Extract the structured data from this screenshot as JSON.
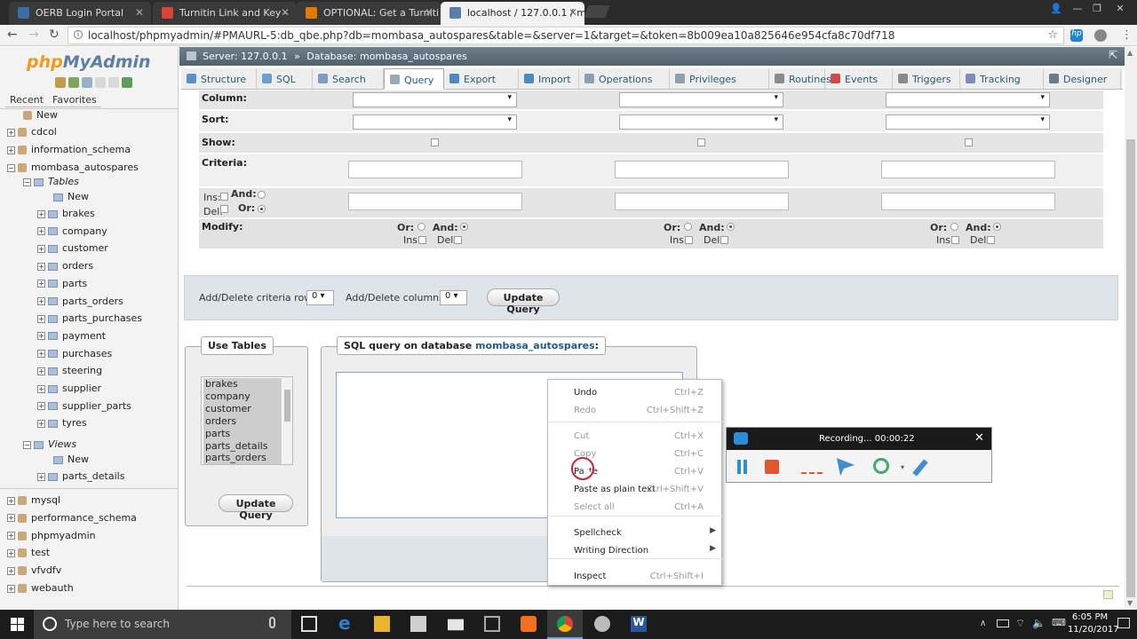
{
  "browser": {
    "tabs": [
      {
        "title": "OERB Login Portal",
        "favicon_color": "#3a6ea5"
      },
      {
        "title": "Turnitin Link and Key -",
        "favicon_color": "#d44638"
      },
      {
        "title": "OPTIONAL: Get a Turniti",
        "favicon_color": "#e07b00"
      },
      {
        "title": "localhost / 127.0.0.1 / m",
        "favicon_color": "#5c7ea9"
      }
    ],
    "url": "localhost/phpmyadmin/#PMAURL-5:db_qbe.php?db=mombasa_autospares&table=&server=1&target=&token=8b009ea10a825646e954cfa8c70df718"
  },
  "sidebar": {
    "logo_php": "php",
    "logo_my": "MyAdmin",
    "tab_recent": "Recent",
    "tab_favorites": "Favorites",
    "new_label": "New",
    "databases_top": [
      "cdcol",
      "information_schema"
    ],
    "active_db": "mombasa_autospares",
    "tables_label": "Tables",
    "tables_new": "New",
    "tables": [
      "brakes",
      "company",
      "customer",
      "orders",
      "parts",
      "parts_orders",
      "parts_purchases",
      "payment",
      "purchases",
      "steering",
      "supplier",
      "supplier_parts",
      "tyres"
    ],
    "views_label": "Views",
    "views_new": "New",
    "views": [
      "parts_details"
    ],
    "databases_bottom": [
      "mysql",
      "performance_schema",
      "phpmyadmin",
      "test",
      "vfvdfv",
      "webauth"
    ]
  },
  "main": {
    "breadcrumb_server": "Server: 127.0.0.1",
    "breadcrumb_db": "Database: mombasa_autospares",
    "tabs": [
      {
        "label": "Structure",
        "color": "#5a8fc7"
      },
      {
        "label": "SQL",
        "color": "#6a9fd3"
      },
      {
        "label": "Search",
        "color": "#7b9ec2"
      },
      {
        "label": "Query",
        "color": "#9aa9b7"
      },
      {
        "label": "Export",
        "color": "#4e8ac0"
      },
      {
        "label": "Import",
        "color": "#4e8ac0"
      },
      {
        "label": "Operations",
        "color": "#8aa0b6"
      },
      {
        "label": "Privileges",
        "color": "#8f9fb0"
      },
      {
        "label": "Routines",
        "color": "#8a8a8a"
      },
      {
        "label": "Events",
        "color": "#cc4b4b"
      },
      {
        "label": "Triggers",
        "color": "#8a8a8a"
      },
      {
        "label": "Tracking",
        "color": "#7b8dbd"
      },
      {
        "label": "Designer",
        "color": "#6b7b8b"
      }
    ],
    "active_tab": "Query",
    "qbe": {
      "column_label": "Column:",
      "sort_label": "Sort:",
      "show_label": "Show:",
      "criteria_label": "Criteria:",
      "ins_label": "Ins:",
      "del_label": "Del:",
      "and_label": "And:",
      "or_label": "Or:",
      "modify_label": "Modify:",
      "mod_or": "Or:",
      "mod_and": "And:",
      "mod_ins": "Ins",
      "mod_del": "Del",
      "add_rows_label": "Add/Delete criteria rows:",
      "add_rows_value": "0",
      "add_cols_label": "Add/Delete columns:",
      "add_cols_value": "0",
      "update_query": "Update Query"
    },
    "use_tables": {
      "legend": "Use Tables",
      "items": [
        "brakes",
        "company",
        "customer",
        "orders",
        "parts",
        "parts_details",
        "parts_orders"
      ],
      "button": "Update Query"
    },
    "sql_box": {
      "legend_prefix": "SQL query on database ",
      "legend_db": "mombasa_autospares",
      "legend_suffix": ":"
    }
  },
  "context_menu": {
    "items": [
      {
        "label": "Undo",
        "shortcut": "Ctrl+Z",
        "disabled": false
      },
      {
        "label": "Redo",
        "shortcut": "Ctrl+Shift+Z",
        "disabled": true
      },
      {
        "label": "Cut",
        "shortcut": "Ctrl+X",
        "disabled": true
      },
      {
        "label": "Copy",
        "shortcut": "Ctrl+C",
        "disabled": true
      },
      {
        "label": "Paste",
        "shortcut": "Ctrl+V",
        "disabled": false
      },
      {
        "label": "Paste as plain text",
        "shortcut": "Ctrl+Shift+V",
        "disabled": false
      },
      {
        "label": "Select all",
        "shortcut": "Ctrl+A",
        "disabled": true
      },
      {
        "label": "Spellcheck",
        "shortcut": "",
        "disabled": false
      },
      {
        "label": "Writing Direction",
        "shortcut": "",
        "disabled": false
      },
      {
        "label": "Inspect",
        "shortcut": "Ctrl+Shift+I",
        "disabled": false
      }
    ]
  },
  "recorder": {
    "status": "Recording... 00:00:22"
  },
  "taskbar": {
    "search_placeholder": "Type here to search",
    "time": "6:05 PM",
    "date": "11/20/2017"
  }
}
